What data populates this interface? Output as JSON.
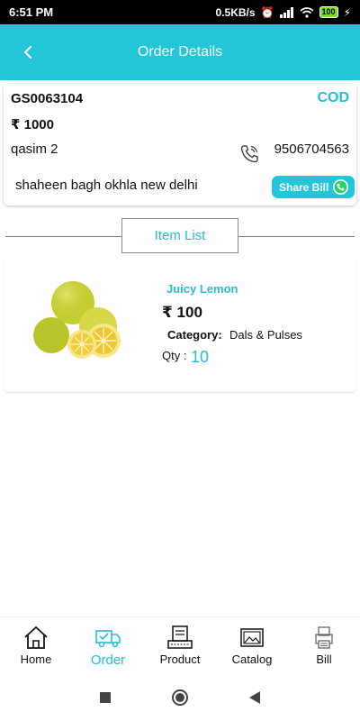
{
  "status_bar": {
    "time": "6:51 PM",
    "net_speed": "0.5KB/s",
    "battery": "100"
  },
  "appbar": {
    "title": "Order Details",
    "back_icon": "back-arrow-icon"
  },
  "order": {
    "id": "GS0063104",
    "payment_mode": "COD",
    "amount": "₹ 1000",
    "customer_name": "qasim 2",
    "phone": "9506704563",
    "address": "shaheen bagh okhla new delhi",
    "share_label": "Share Bill"
  },
  "item_list_label": "Item List",
  "items": [
    {
      "name": "Juicy Lemon",
      "price": "₹ 100",
      "category_label": "Category:",
      "category": "Dals & Pulses",
      "qty_label": "Qty :",
      "qty": "10"
    }
  ],
  "bottom_nav": [
    {
      "label": "Home",
      "icon": "home-icon",
      "active": false
    },
    {
      "label": "Order",
      "icon": "delivery-truck-icon",
      "active": true
    },
    {
      "label": "Product",
      "icon": "product-icon",
      "active": false
    },
    {
      "label": "Catalog",
      "icon": "catalog-icon",
      "active": false
    },
    {
      "label": "Bill",
      "icon": "bill-printer-icon",
      "active": false
    }
  ],
  "colors": {
    "accent": "#23c6d8",
    "whatsapp": "#25d366"
  }
}
